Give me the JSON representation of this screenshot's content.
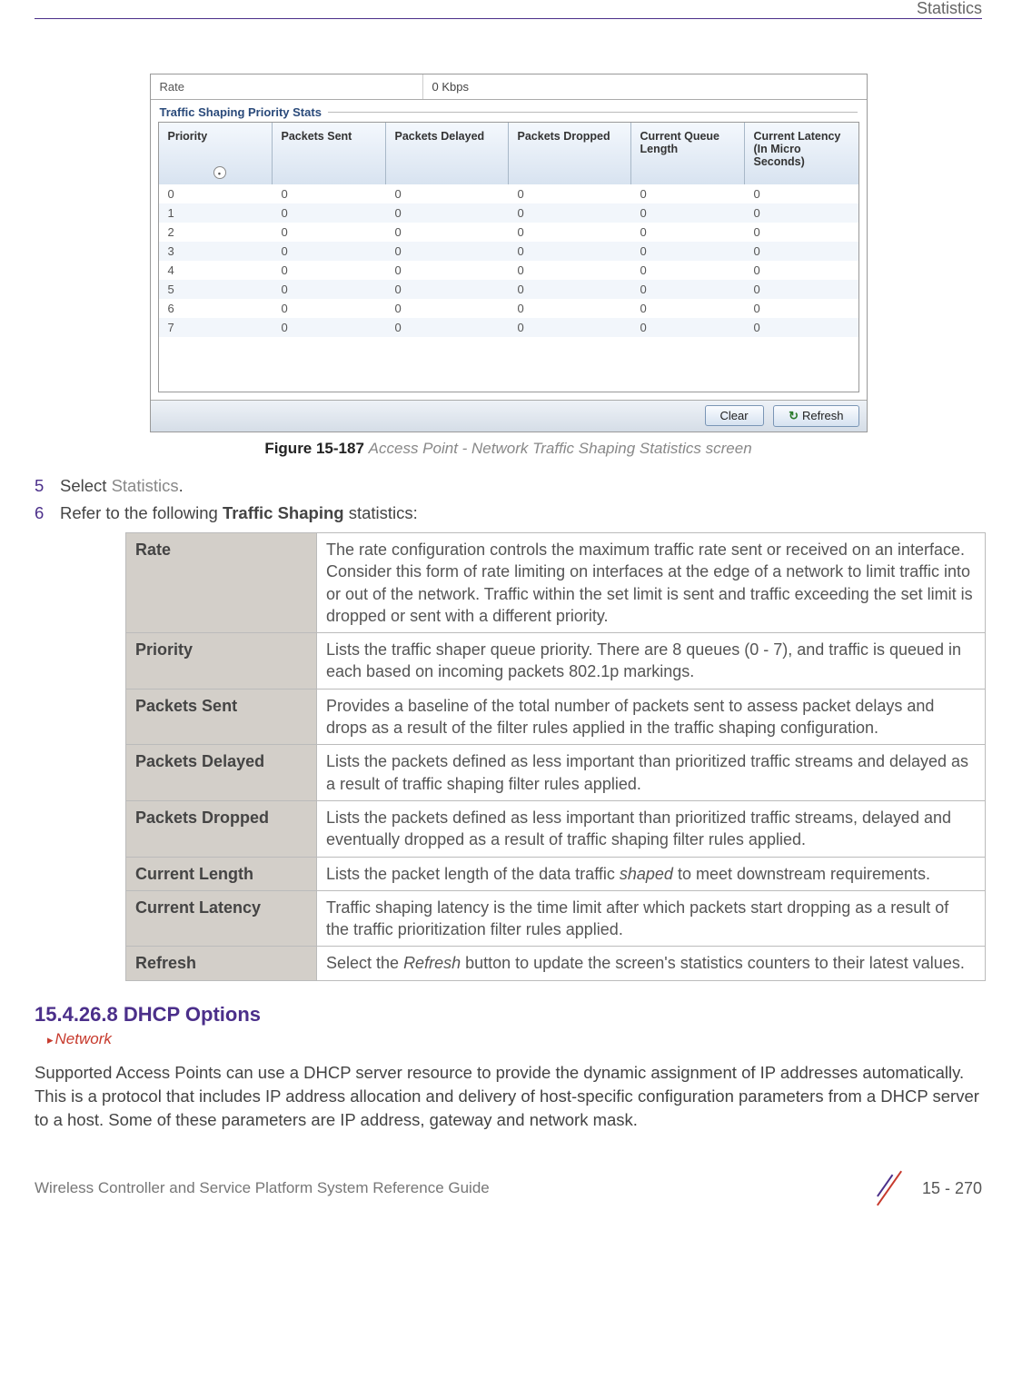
{
  "header": {
    "section": "Statistics"
  },
  "screenshot": {
    "rate": {
      "label": "Rate",
      "value": "0 Kbps"
    },
    "fieldset": "Traffic Shaping Priority Stats",
    "columns": [
      "Priority",
      "Packets Sent",
      "Packets Delayed",
      "Packets Dropped",
      "Current Queue Length",
      "Current Latency (In Micro Seconds)"
    ],
    "rows": [
      [
        "0",
        "0",
        "0",
        "0",
        "0",
        "0"
      ],
      [
        "1",
        "0",
        "0",
        "0",
        "0",
        "0"
      ],
      [
        "2",
        "0",
        "0",
        "0",
        "0",
        "0"
      ],
      [
        "3",
        "0",
        "0",
        "0",
        "0",
        "0"
      ],
      [
        "4",
        "0",
        "0",
        "0",
        "0",
        "0"
      ],
      [
        "5",
        "0",
        "0",
        "0",
        "0",
        "0"
      ],
      [
        "6",
        "0",
        "0",
        "0",
        "0",
        "0"
      ],
      [
        "7",
        "0",
        "0",
        "0",
        "0",
        "0"
      ]
    ],
    "buttons": {
      "clear": "Clear",
      "refresh": "Refresh"
    }
  },
  "figure": {
    "label": "Figure 15-187",
    "desc": "Access Point - Network Traffic Shaping Statistics screen"
  },
  "steps": {
    "s5_num": "5",
    "s5_a": "Select ",
    "s5_b": "Statistics",
    "s5_c": ".",
    "s6_num": "6",
    "s6_a": "Refer to the following ",
    "s6_b": "Traffic Shaping",
    "s6_c": " statistics:"
  },
  "defs": [
    {
      "term": "Rate",
      "def": "The rate configuration controls the maximum traffic rate sent or received on an interface. Consider this form of rate limiting on interfaces at the edge of a network to limit traffic into or out of the network. Traffic within the set limit is sent and traffic exceeding the set limit is dropped or sent with a different priority."
    },
    {
      "term": "Priority",
      "def": "Lists the traffic shaper queue priority. There are 8 queues (0 - 7), and traffic is queued in each based on incoming packets 802.1p markings."
    },
    {
      "term": "Packets Sent",
      "def": "Provides a baseline of the total number of packets sent to assess packet delays and drops as a result of the filter rules applied in the traffic shaping configuration."
    },
    {
      "term": "Packets Delayed",
      "def": "Lists the packets defined as less important than prioritized traffic streams and delayed as a result of traffic shaping filter rules applied."
    },
    {
      "term": "Packets Dropped",
      "def": "Lists the packets defined as less important than prioritized traffic streams, delayed and eventually dropped as a result of traffic shaping filter rules applied."
    },
    {
      "term": "Current Length",
      "def_pre": "Lists the packet length of the data traffic ",
      "def_em": "shaped",
      "def_post": " to meet downstream requirements."
    },
    {
      "term": "Current Latency",
      "def": "Traffic shaping latency is the time limit after which packets start dropping as a result of the traffic prioritization filter rules applied."
    },
    {
      "term": "Refresh",
      "def_pre": "Select the ",
      "def_em": "Refresh",
      "def_post": " button to update the screen's statistics counters to their latest values."
    }
  ],
  "section": {
    "heading": "15.4.26.8 DHCP Options",
    "crumb": "Network",
    "para": "Supported Access Points can use a DHCP server resource to provide the dynamic assignment of IP addresses automatically. This is a protocol that includes IP address allocation and delivery of host-specific configuration parameters from a DHCP server to a host. Some of these parameters are IP address, gateway and network mask."
  },
  "footer": {
    "guide": "Wireless Controller and Service Platform System Reference Guide",
    "page": "15 - 270"
  },
  "chart_data": {
    "type": "table",
    "title": "Traffic Shaping Priority Stats",
    "columns": [
      "Priority",
      "Packets Sent",
      "Packets Delayed",
      "Packets Dropped",
      "Current Queue Length",
      "Current Latency (In Micro Seconds)"
    ],
    "rows": [
      {
        "Priority": 0,
        "Packets Sent": 0,
        "Packets Delayed": 0,
        "Packets Dropped": 0,
        "Current Queue Length": 0,
        "Current Latency (In Micro Seconds)": 0
      },
      {
        "Priority": 1,
        "Packets Sent": 0,
        "Packets Delayed": 0,
        "Packets Dropped": 0,
        "Current Queue Length": 0,
        "Current Latency (In Micro Seconds)": 0
      },
      {
        "Priority": 2,
        "Packets Sent": 0,
        "Packets Delayed": 0,
        "Packets Dropped": 0,
        "Current Queue Length": 0,
        "Current Latency (In Micro Seconds)": 0
      },
      {
        "Priority": 3,
        "Packets Sent": 0,
        "Packets Delayed": 0,
        "Packets Dropped": 0,
        "Current Queue Length": 0,
        "Current Latency (In Micro Seconds)": 0
      },
      {
        "Priority": 4,
        "Packets Sent": 0,
        "Packets Delayed": 0,
        "Packets Dropped": 0,
        "Current Queue Length": 0,
        "Current Latency (In Micro Seconds)": 0
      },
      {
        "Priority": 5,
        "Packets Sent": 0,
        "Packets Delayed": 0,
        "Packets Dropped": 0,
        "Current Queue Length": 0,
        "Current Latency (In Micro Seconds)": 0
      },
      {
        "Priority": 6,
        "Packets Sent": 0,
        "Packets Delayed": 0,
        "Packets Dropped": 0,
        "Current Queue Length": 0,
        "Current Latency (In Micro Seconds)": 0
      },
      {
        "Priority": 7,
        "Packets Sent": 0,
        "Packets Delayed": 0,
        "Packets Dropped": 0,
        "Current Queue Length": 0,
        "Current Latency (In Micro Seconds)": 0
      }
    ]
  }
}
